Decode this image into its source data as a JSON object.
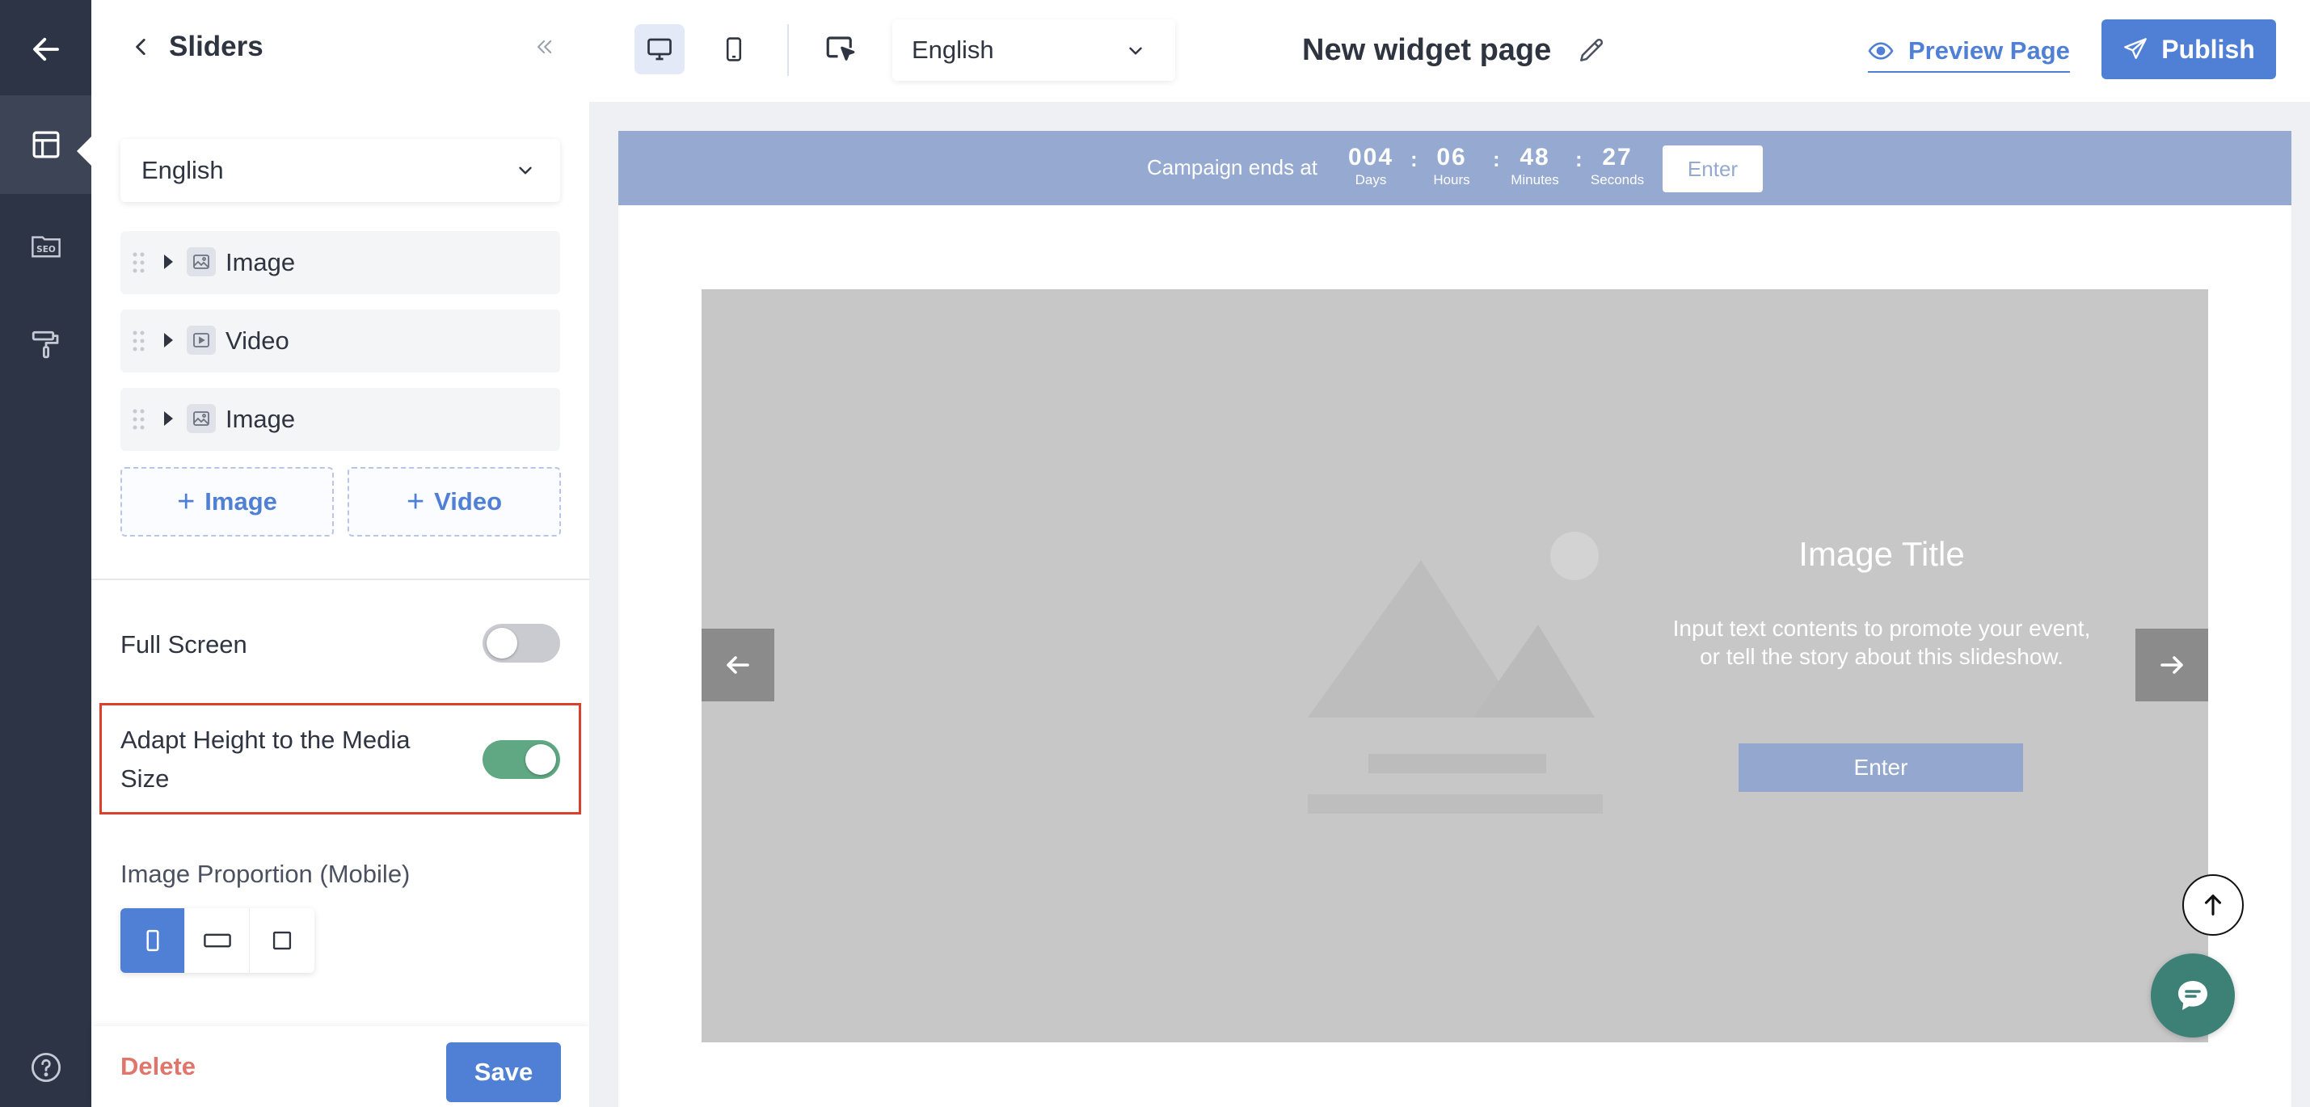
{
  "rail": {
    "items": [
      {
        "icon": "arrow-left-icon"
      },
      {
        "icon": "layout-icon"
      },
      {
        "icon": "seo-icon",
        "text": "SEO"
      },
      {
        "icon": "paint-roller-icon"
      },
      {
        "icon": "help-circle-icon",
        "text": "?"
      }
    ]
  },
  "panel": {
    "title": "Sliders",
    "language": "English",
    "media_items": [
      {
        "label": "Image",
        "icon": "image-icon"
      },
      {
        "label": "Video",
        "icon": "video-icon"
      },
      {
        "label": "Image",
        "icon": "image-icon"
      }
    ],
    "add_image_label": "Image",
    "add_video_label": "Video",
    "full_screen_label": "Full Screen",
    "full_screen_on": false,
    "adapt_height_label_line1": "Adapt Height to the Media",
    "adapt_height_label_line2": "Size",
    "adapt_height_on": true,
    "image_proportion_label": "Image Proportion (Mobile)",
    "proportion_options": [
      "portrait",
      "landscape",
      "square"
    ],
    "proportion_selected": "portrait",
    "delete_label": "Delete",
    "save_label": "Save"
  },
  "topbar": {
    "language": "English",
    "page_title": "New widget page",
    "preview_label": "Preview Page",
    "publish_label": "Publish"
  },
  "campaign": {
    "text": "Campaign ends at",
    "days": "004",
    "days_label": "Days",
    "hours": "06",
    "hours_label": "Hours",
    "minutes": "48",
    "minutes_label": "Minutes",
    "seconds": "27",
    "seconds_label": "Seconds",
    "enter_label": "Enter"
  },
  "slide": {
    "title": "Image Title",
    "description": "Input text contents to promote your event, or tell the story about this slideshow.",
    "enter_label": "Enter"
  },
  "colors": {
    "rail_bg": "#2d3446",
    "accent": "#4f80d6",
    "toggle_on": "#5fa883",
    "highlight": "#d9412d",
    "campaign_bg": "#95a9d1",
    "chat": "#3d8176"
  }
}
